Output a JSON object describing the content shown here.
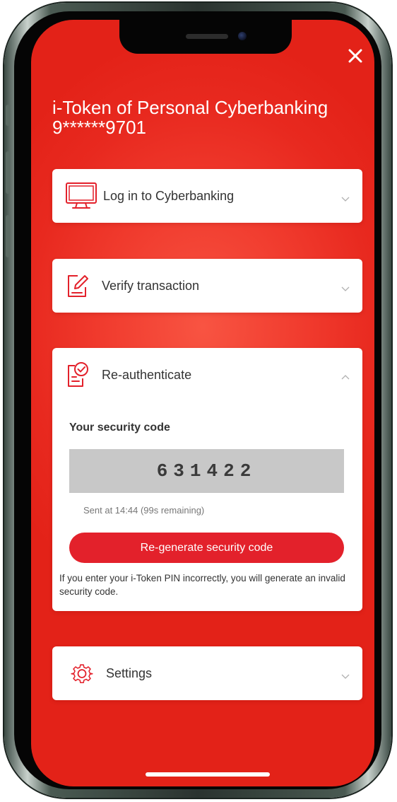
{
  "app": {
    "title_line1": "i-Token of Personal Cyberbanking",
    "title_line2": "9******9701"
  },
  "header": {
    "close_icon": "close-icon"
  },
  "sections": [
    {
      "label": "Log in to Cyberbanking",
      "icon": "monitor-icon",
      "expanded": false
    },
    {
      "label": "Verify transaction",
      "icon": "edit-document-icon",
      "expanded": false
    },
    {
      "label": "Re-authenticate",
      "icon": "document-check-icon",
      "expanded": true
    },
    {
      "label": "Settings",
      "icon": "gear-icon",
      "expanded": false
    }
  ],
  "reauth": {
    "code_title": "Your security code",
    "code": "631422",
    "sent_text": "Sent at 14:44 (99s remaining)",
    "button_label": "Re-generate security code",
    "note": "If you enter your i-Token PIN incorrectly, you will generate an invalid security code."
  },
  "colors": {
    "brand_red": "#e3212b",
    "background_red": "#f03a2d",
    "code_box": "#c8c8c8"
  }
}
